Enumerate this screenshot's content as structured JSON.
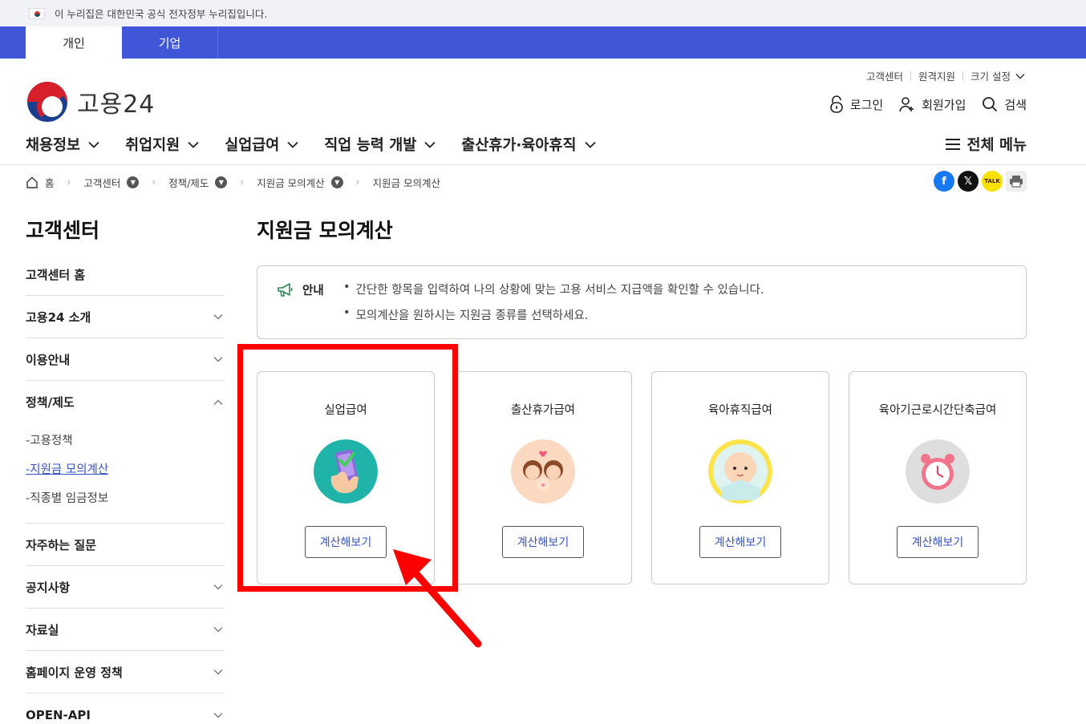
{
  "gov_banner": {
    "text": "이 누리집은 대한민국 공식 전자정부 누리집입니다."
  },
  "type_tabs": [
    {
      "label": "개인"
    },
    {
      "label": "기업"
    }
  ],
  "logo": {
    "text": "고용24"
  },
  "util_links": [
    {
      "label": "고객센터"
    },
    {
      "label": "원격지원"
    },
    {
      "label": "크기 설정"
    }
  ],
  "user_links": [
    {
      "label": "로그인"
    },
    {
      "label": "회원가입"
    },
    {
      "label": "검색"
    }
  ],
  "gnb": [
    {
      "label": "채용정보"
    },
    {
      "label": "취업지원"
    },
    {
      "label": "실업급여"
    },
    {
      "label": "직업 능력 개발"
    },
    {
      "label": "출산휴가·육아휴직"
    }
  ],
  "all_menu": {
    "label": "전체 메뉴"
  },
  "breadcrumb": [
    {
      "label": "홈"
    },
    {
      "label": "고객센터"
    },
    {
      "label": "정책/제도"
    },
    {
      "label": "지원금 모의계산"
    },
    {
      "label": "지원금 모의계산"
    }
  ],
  "share": {
    "kakao_label": "TALK"
  },
  "sidebar": {
    "title": "고객센터",
    "items": [
      {
        "label": "고객센터 홈"
      },
      {
        "label": "고용24 소개"
      },
      {
        "label": "이용안내"
      },
      {
        "label": "정책/제도"
      },
      {
        "label": "자주하는 질문"
      },
      {
        "label": "공지사항"
      },
      {
        "label": "자료실"
      },
      {
        "label": "홈페이지 운영 정책"
      },
      {
        "label": "OPEN-API"
      }
    ],
    "sub_items": [
      {
        "label": "-고용정책"
      },
      {
        "label": "-지원금 모의계산"
      },
      {
        "label": "-직종별 임금정보"
      }
    ]
  },
  "main": {
    "title": "지원금 모의계산",
    "notice": {
      "label": "안내",
      "lines": [
        "간단한 항목을 입력하여 나의 상황에 맞는 고용 서비스 지급액을 확인할 수 있습니다.",
        "모의계산을 원하시는 지원금 종류를 선택하세요."
      ]
    },
    "cards": [
      {
        "title": "실업급여",
        "button": "계산해보기"
      },
      {
        "title": "출산휴가급여",
        "button": "계산해보기"
      },
      {
        "title": "육아휴직급여",
        "button": "계산해보기"
      },
      {
        "title": "육아기근로시간단축급여",
        "button": "계산해보기"
      }
    ]
  },
  "colors": {
    "brand_blue": "#3f56d8",
    "link_blue": "#3553c7",
    "annotation_red": "#ff0000"
  }
}
